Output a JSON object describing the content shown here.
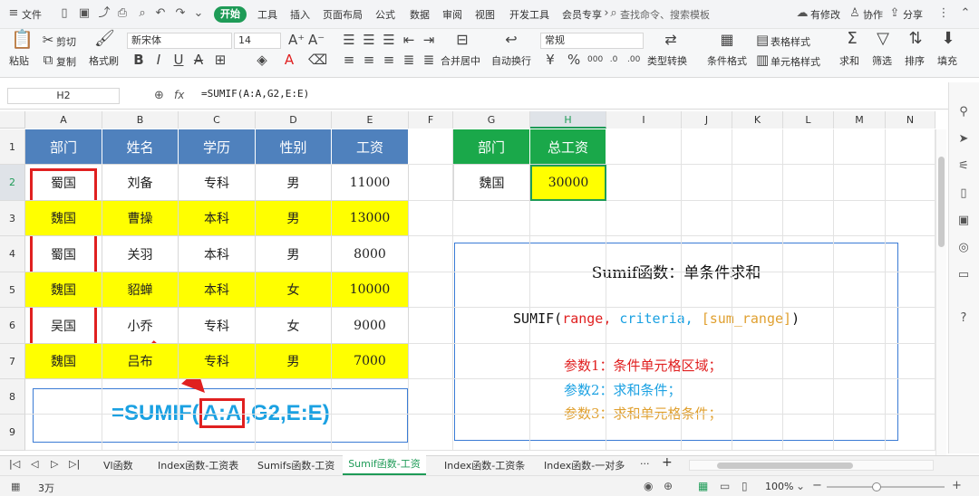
{
  "menu": {
    "file": "文件",
    "tabs": [
      "开始",
      "工具",
      "插入",
      "页面布局",
      "公式",
      "数据",
      "审阅",
      "视图",
      "开发工具",
      "会员专享"
    ],
    "search_placeholder": "查找命令、搜索模板",
    "right": [
      "有修改",
      "协作",
      "分享"
    ]
  },
  "ribbon": {
    "paste": "粘贴",
    "cut": "剪切",
    "copy": "复制",
    "format_painter": "格式刷",
    "font_name": "新宋体",
    "font_size": "14",
    "number_format": "常规",
    "merge_center": "合并居中",
    "wrap_text": "自动换行",
    "type_convert": "类型转换",
    "conditional_format": "条件格式",
    "table_style": "表格样式",
    "cell_style": "单元格样式",
    "sum": "求和",
    "filter": "筛选",
    "sort": "排序",
    "fill": "填充"
  },
  "formula_bar": {
    "name_box": "H2",
    "fx": "fx",
    "formula": "=SUMIF(A:A,G2,E:E)"
  },
  "columns": [
    "A",
    "B",
    "C",
    "D",
    "E",
    "F",
    "G",
    "H",
    "I",
    "J",
    "K",
    "L",
    "M",
    "N"
  ],
  "rows": [
    "1",
    "2",
    "3",
    "4",
    "5",
    "6",
    "7",
    "8",
    "9"
  ],
  "table": {
    "headers": [
      "部门",
      "姓名",
      "学历",
      "性别",
      "工资"
    ],
    "rows": [
      [
        "蜀国",
        "刘备",
        "专科",
        "男",
        "11000"
      ],
      [
        "魏国",
        "曹操",
        "本科",
        "男",
        "13000"
      ],
      [
        "蜀国",
        "关羽",
        "本科",
        "男",
        "8000"
      ],
      [
        "魏国",
        "貂蝉",
        "本科",
        "女",
        "10000"
      ],
      [
        "吴国",
        "小乔",
        "专科",
        "女",
        "9000"
      ],
      [
        "魏国",
        "吕布",
        "专科",
        "男",
        "7000"
      ]
    ]
  },
  "lookup": {
    "headers": [
      "部门",
      "总工资"
    ],
    "criteria": "魏国",
    "result": "30000"
  },
  "formula_display": {
    "prefix": "=SUMIF(",
    "highlight": "A:A",
    "suffix": ",G2,E:E)"
  },
  "explain": {
    "title": "Sumif函数：单条件求和",
    "syntax_fn": "SUMIF(",
    "syntax_range": "range,",
    "syntax_criteria": "criteria,",
    "syntax_sum": "[sum_range]",
    "syntax_close": ")",
    "param1": "参数1：条件单元格区域；",
    "param2": "参数2：求和条件；",
    "param3": "参数3：求和单元格条件；"
  },
  "sheet_tabs": [
    "Vl函数",
    "Index函数-工资表",
    "Sumifs函数-工资",
    "Sumif函数-工资",
    "Index函数-工资条",
    "Index函数-一对多"
  ],
  "status": {
    "left": "3万",
    "zoom": "100%"
  },
  "colors": {
    "header_blue": "#4f81bd",
    "header_green": "#1aa84a",
    "highlight_yellow": "#ffff00",
    "accent_red": "#e02020",
    "text_blue": "#1ba1e2",
    "param_orange": "#e0a030"
  }
}
